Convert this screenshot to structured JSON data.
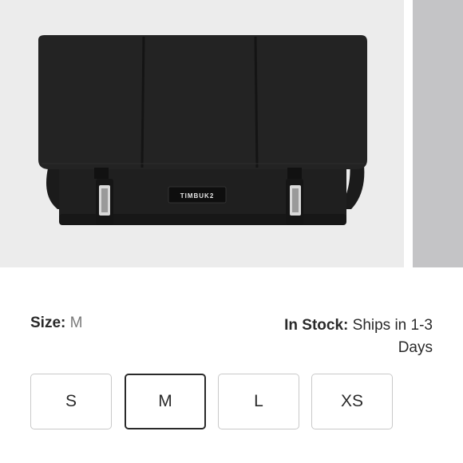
{
  "product": {
    "brand_label": "TIMBUK2"
  },
  "gallery": {
    "main_image": "black-messenger-bag"
  },
  "size": {
    "label": "Size:",
    "selected_value": "M",
    "options": [
      "S",
      "M",
      "L",
      "XS"
    ],
    "selected_index": 1
  },
  "availability": {
    "label": "In Stock:",
    "text_line1": "Ships in 1-3",
    "text_line2": "Days"
  },
  "colors": {
    "gallery_bg": "#ececec",
    "next_slide_bg": "#c4c4c6",
    "selected_border": "#2a2a2a",
    "option_border": "#c9c9c9"
  }
}
